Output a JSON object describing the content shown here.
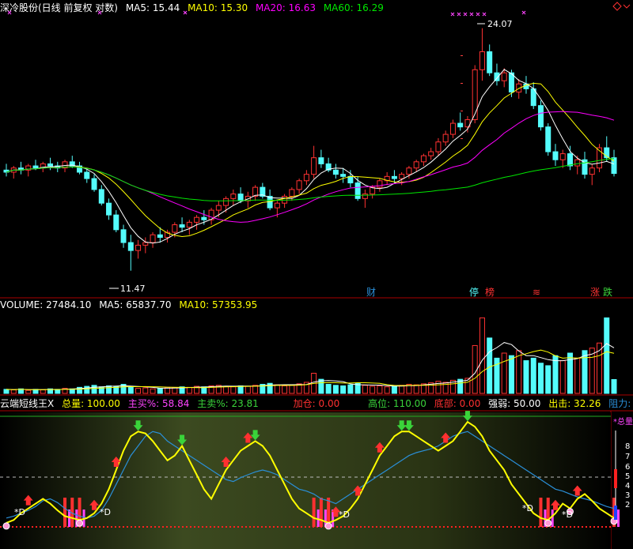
{
  "colors": {
    "up": "#ff3232",
    "down": "#54fcfc",
    "ma5": "#ffffff",
    "ma10": "#ffff00",
    "ma20": "#ff00ff",
    "ma60": "#00e600",
    "grid": "#aa0000",
    "yellow": "#ffff00",
    "blue": "#2a8fd8",
    "magenta": "#ff44ff",
    "red": "#ff3030",
    "green": "#3ad33a",
    "cyan": "#54fcfc"
  },
  "price_header": {
    "title": "深冷股份(日线 前复权 对数)",
    "ma5": "MA5: 15.44",
    "ma10": "MA10: 15.30",
    "ma20": "MA20: 16.63",
    "ma60": "MA60: 16.29"
  },
  "price_annotations": {
    "high": "24.07",
    "low": "11.47"
  },
  "event_tags": [
    {
      "label": "财",
      "color": "#2a8fd8"
    },
    {
      "label": "停",
      "color": "#54fcfc"
    },
    {
      "label": "榜",
      "color": "#ff3232"
    },
    {
      "label": "≋",
      "color": "#ff3232"
    },
    {
      "label": "涨",
      "color": "#ff3232"
    },
    {
      "label": "跌",
      "color": "#3ad33a"
    }
  ],
  "volume_header": {
    "volume": "VOLUME: 27484.10",
    "ma5": "MA5: 65837.70",
    "ma10": "MA10: 57353.95"
  },
  "indicator_header": {
    "name": "云端短线王X",
    "total": "总量: 100.00",
    "main_buy": "主买%: 58.84",
    "main_sell": "主卖%: 23.81",
    "add_position": "加仓: 0.00",
    "high_pos": "高位: 110.00",
    "bottom": "底部: 0.00",
    "strength": "强弱: 50.00",
    "exit": "出击: 32.26",
    "resistance": "阻力: 18.20"
  },
  "right_scale": {
    "title": "*总量",
    "ticks": [
      "8",
      "7",
      "6",
      "5",
      "4",
      "3",
      "2"
    ]
  },
  "d_marks": [
    "*D",
    "*D",
    "*D",
    "*D",
    "*D"
  ],
  "chart_data": [
    {
      "type": "candlestick",
      "title": "深冷股份(日线 前复权 对数)",
      "high_label": 24.07,
      "low_label": 11.47,
      "ohlc": [
        [
          15.6,
          15.9,
          15.3,
          15.5
        ],
        [
          15.5,
          15.8,
          15.2,
          15.7
        ],
        [
          15.7,
          16.0,
          15.4,
          15.6
        ],
        [
          15.6,
          15.9,
          15.3,
          15.8
        ],
        [
          15.8,
          16.1,
          15.6,
          15.7
        ],
        [
          15.7,
          16.0,
          15.5,
          15.9
        ],
        [
          15.9,
          16.2,
          15.6,
          15.8
        ],
        [
          15.8,
          16.0,
          15.5,
          15.7
        ],
        [
          15.7,
          16.1,
          15.5,
          16.0
        ],
        [
          16.0,
          16.3,
          15.7,
          15.8
        ],
        [
          15.8,
          16.0,
          15.4,
          15.5
        ],
        [
          15.5,
          15.7,
          15.0,
          15.2
        ],
        [
          15.2,
          15.4,
          14.6,
          14.7
        ],
        [
          14.7,
          14.9,
          14.0,
          14.1
        ],
        [
          14.1,
          14.3,
          13.4,
          13.6
        ],
        [
          13.6,
          13.8,
          12.9,
          13.0
        ],
        [
          13.0,
          13.2,
          12.3,
          12.5
        ],
        [
          12.5,
          12.8,
          11.47,
          12.2
        ],
        [
          12.2,
          12.6,
          11.9,
          12.4
        ],
        [
          12.4,
          12.7,
          12.1,
          12.5
        ],
        [
          12.5,
          12.9,
          12.3,
          12.8
        ],
        [
          12.8,
          13.1,
          12.5,
          12.7
        ],
        [
          12.7,
          13.0,
          12.5,
          12.9
        ],
        [
          12.9,
          13.3,
          12.7,
          13.2
        ],
        [
          13.2,
          13.5,
          12.9,
          13.1
        ],
        [
          13.1,
          13.4,
          12.8,
          13.3
        ],
        [
          13.3,
          13.6,
          13.0,
          13.5
        ],
        [
          13.5,
          13.8,
          13.2,
          13.4
        ],
        [
          13.4,
          13.9,
          13.2,
          13.8
        ],
        [
          13.8,
          14.2,
          13.5,
          14.0
        ],
        [
          14.0,
          14.4,
          13.7,
          14.3
        ],
        [
          14.3,
          14.7,
          14.0,
          14.5
        ],
        [
          14.5,
          14.8,
          14.1,
          14.2
        ],
        [
          14.2,
          14.6,
          13.9,
          14.4
        ],
        [
          14.4,
          14.9,
          14.2,
          14.8
        ],
        [
          14.8,
          15.0,
          14.3,
          14.4
        ],
        [
          14.4,
          14.7,
          13.8,
          13.9
        ],
        [
          13.9,
          14.2,
          13.5,
          14.1
        ],
        [
          14.1,
          14.5,
          13.9,
          14.4
        ],
        [
          14.4,
          14.8,
          14.2,
          14.7
        ],
        [
          14.7,
          15.2,
          14.5,
          15.1
        ],
        [
          15.1,
          15.6,
          14.9,
          15.4
        ],
        [
          15.4,
          16.8,
          15.2,
          16.2
        ],
        [
          16.2,
          16.6,
          15.7,
          15.9
        ],
        [
          15.9,
          16.2,
          15.5,
          15.6
        ],
        [
          15.6,
          15.9,
          15.2,
          15.4
        ],
        [
          15.4,
          15.7,
          15.0,
          15.3
        ],
        [
          15.3,
          15.6,
          14.8,
          15.0
        ],
        [
          15.0,
          15.3,
          14.2,
          14.3
        ],
        [
          14.3,
          14.7,
          13.9,
          14.5
        ],
        [
          14.5,
          14.9,
          14.3,
          14.8
        ],
        [
          14.8,
          15.2,
          14.6,
          15.1
        ],
        [
          15.1,
          15.5,
          14.9,
          15.3
        ],
        [
          15.3,
          15.6,
          15.0,
          15.2
        ],
        [
          15.2,
          15.5,
          14.9,
          15.4
        ],
        [
          15.4,
          15.8,
          15.2,
          15.7
        ],
        [
          15.7,
          16.1,
          15.5,
          16.0
        ],
        [
          16.0,
          16.4,
          15.8,
          16.3
        ],
        [
          16.3,
          16.7,
          16.1,
          16.5
        ],
        [
          16.5,
          17.2,
          16.3,
          17.0
        ],
        [
          17.0,
          17.6,
          16.8,
          17.4
        ],
        [
          17.4,
          18.2,
          17.2,
          18.0
        ],
        [
          18.0,
          18.6,
          17.6,
          17.8
        ],
        [
          17.8,
          18.4,
          17.5,
          18.2
        ],
        [
          18.2,
          21.5,
          18.0,
          21.2
        ],
        [
          21.2,
          24.07,
          20.5,
          22.4
        ],
        [
          22.4,
          22.9,
          20.8,
          21.0
        ],
        [
          21.0,
          21.6,
          20.2,
          20.5
        ],
        [
          20.5,
          21.3,
          20.1,
          21.0
        ],
        [
          21.0,
          21.2,
          19.5,
          19.8
        ],
        [
          19.8,
          20.6,
          19.4,
          20.3
        ],
        [
          20.3,
          20.8,
          19.7,
          20.0
        ],
        [
          20.0,
          20.4,
          18.8,
          19.0
        ],
        [
          19.0,
          19.3,
          17.6,
          17.8
        ],
        [
          17.8,
          18.0,
          16.3,
          16.5
        ],
        [
          16.5,
          16.9,
          15.8,
          16.1
        ],
        [
          16.1,
          16.6,
          15.7,
          16.4
        ],
        [
          16.4,
          16.8,
          15.6,
          15.8
        ],
        [
          15.8,
          16.3,
          15.4,
          16.1
        ],
        [
          16.1,
          16.5,
          15.2,
          15.4
        ],
        [
          15.4,
          15.9,
          14.9,
          15.7
        ],
        [
          15.7,
          16.9,
          15.5,
          16.7
        ],
        [
          16.7,
          17.3,
          16.0,
          16.2
        ],
        [
          16.2,
          16.6,
          15.3,
          15.44
        ]
      ]
    },
    {
      "type": "bar",
      "title": "VOLUME",
      "values": [
        8,
        7,
        9,
        6,
        8,
        7,
        9,
        8,
        10,
        9,
        12,
        14,
        16,
        13,
        15,
        14,
        18,
        12,
        10,
        11,
        9,
        10,
        12,
        11,
        13,
        12,
        14,
        13,
        15,
        16,
        14,
        13,
        15,
        14,
        16,
        18,
        20,
        17,
        15,
        16,
        19,
        22,
        40,
        28,
        18,
        16,
        15,
        17,
        20,
        16,
        14,
        15,
        13,
        14,
        16,
        18,
        17,
        19,
        21,
        24,
        22,
        26,
        28,
        30,
        95,
        150,
        110,
        70,
        80,
        75,
        85,
        65,
        70,
        60,
        55,
        75,
        65,
        80,
        70,
        85,
        90,
        100,
        150,
        27.48
      ],
      "ylim": [
        0,
        160
      ]
    },
    {
      "type": "line",
      "title": "云端短线王X",
      "series": [
        {
          "name": "",
          "values": [
            5,
            8,
            15,
            20,
            25,
            30,
            25,
            18,
            12,
            10,
            8,
            10,
            15,
            25,
            40,
            60,
            80,
            95,
            100,
            98,
            90,
            80,
            70,
            75,
            85,
            70,
            55,
            40,
            30,
            45,
            60,
            70,
            80,
            85,
            90,
            85,
            75,
            60,
            45,
            30,
            20,
            15,
            10,
            8,
            5,
            8,
            12,
            20,
            30,
            45,
            60,
            75,
            85,
            95,
            100,
            100,
            95,
            90,
            85,
            80,
            85,
            90,
            100,
            110,
            105,
            95,
            80,
            70,
            60,
            45,
            35,
            25,
            15,
            10,
            8,
            15,
            25,
            20,
            30,
            35,
            28,
            20,
            15,
            10
          ]
        },
        {
          "name": "",
          "values": [
            10,
            12,
            15,
            18,
            22,
            28,
            30,
            26,
            20,
            15,
            12,
            10,
            12,
            18,
            30,
            45,
            60,
            75,
            85,
            95,
            100,
            98,
            90,
            85,
            80,
            75,
            70,
            65,
            60,
            55,
            50,
            48,
            52,
            55,
            58,
            60,
            58,
            55,
            50,
            45,
            40,
            38,
            35,
            30,
            28,
            25,
            30,
            35,
            40,
            45,
            50,
            55,
            60,
            65,
            70,
            75,
            78,
            80,
            82,
            85,
            90,
            95,
            98,
            100,
            95,
            90,
            85,
            80,
            75,
            70,
            65,
            60,
            55,
            50,
            45,
            40,
            38,
            35,
            32,
            30,
            28,
            25,
            22,
            20
          ]
        }
      ]
    }
  ]
}
